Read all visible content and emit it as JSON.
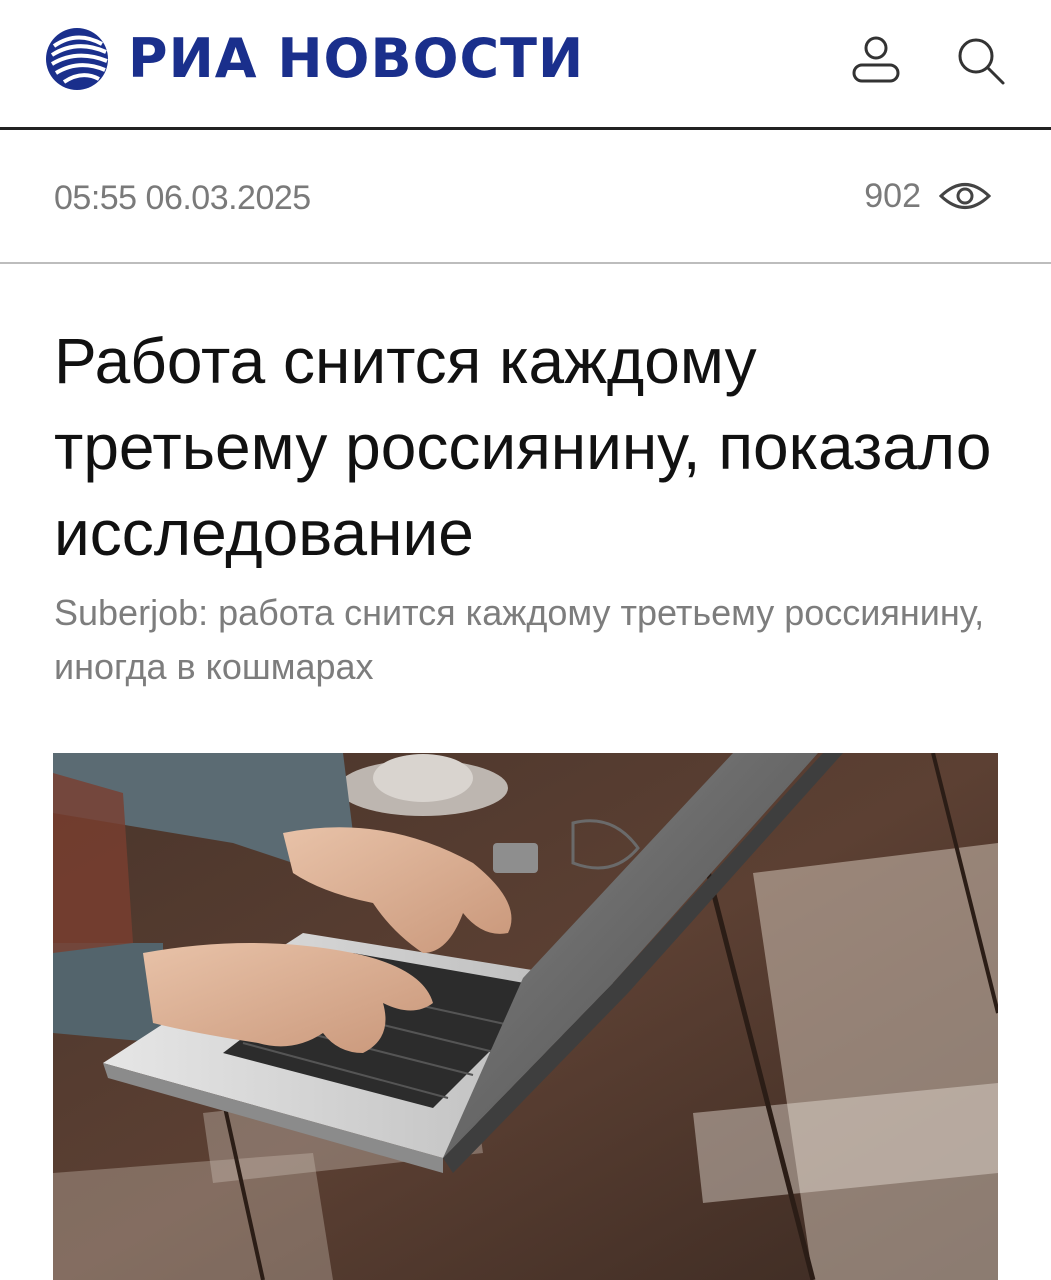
{
  "header": {
    "logo_text": "РИА НОВОСТИ",
    "logo_icon": "ria-globe-icon",
    "user_icon": "user-icon",
    "search_icon": "search-icon",
    "brand_color": "#1a2f8c"
  },
  "meta": {
    "datetime": "05:55 06.03.2025",
    "views": "902",
    "views_icon": "eye-icon"
  },
  "article": {
    "title": "Работа снится каждому третьему россиянину, показало исследование",
    "subtitle": "Suberjob: работа снится каждому третьему россиянину, иногда в кошмарах",
    "image_icon": "laptop-typing-photo"
  },
  "colors": {
    "text_primary": "#111111",
    "text_secondary": "#7a7a7a",
    "divider": "#222222"
  }
}
